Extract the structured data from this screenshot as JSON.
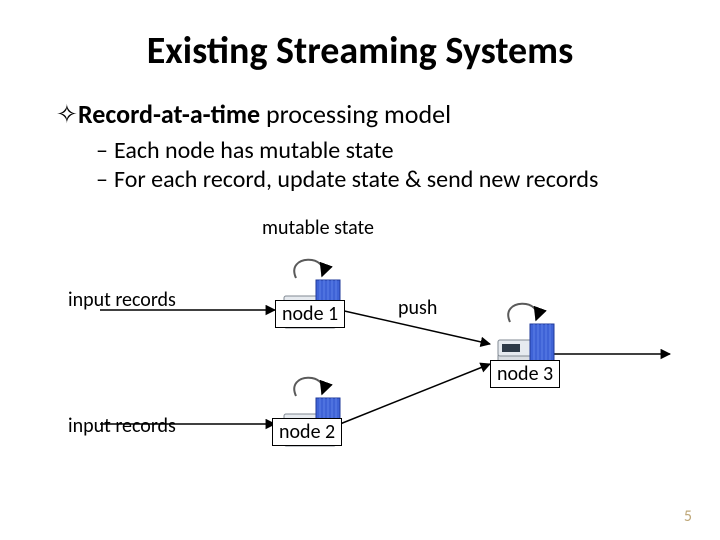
{
  "title": "Existing Streaming Systems",
  "bullets": {
    "main": {
      "marker": "✧",
      "bold": "Record-at-a-time",
      "rest": " processing model"
    },
    "sub1": {
      "dash": "–",
      "text": "Each node has mutable state"
    },
    "sub2": {
      "dash": "–",
      "text": "For each record, update state & send new records"
    }
  },
  "diagram": {
    "mutable_state": "mutable state",
    "input_records_1": "input records",
    "input_records_2": "input records",
    "push": "push",
    "node1": "node 1",
    "node2": "node 2",
    "node3": "node 3"
  },
  "page_number": "5"
}
